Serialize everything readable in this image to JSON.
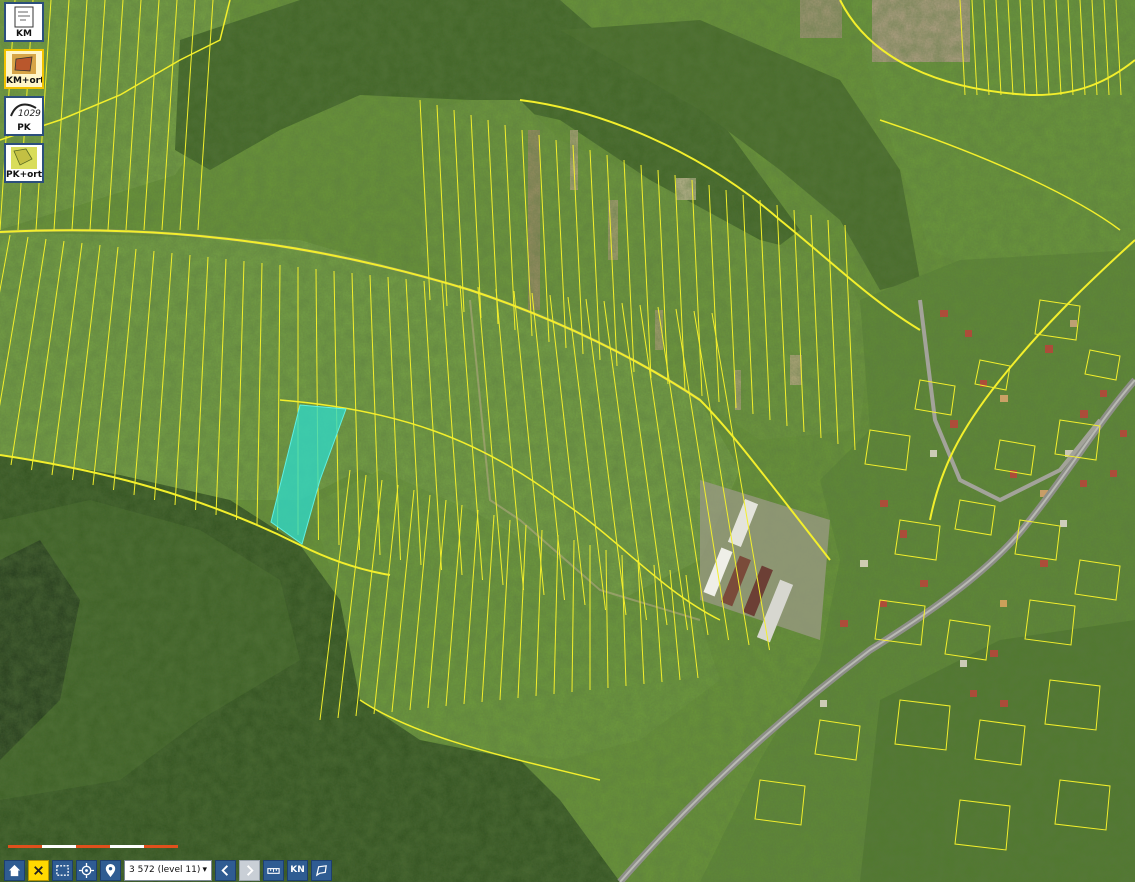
{
  "map": {
    "view": "aerial orthophoto with cadastral parcel boundaries",
    "parcel_line_color": "#f3ef2c",
    "highlight_color": "#2fd8c8",
    "forest_color": "#2c4a1c",
    "meadow_color": "#6b9a38"
  },
  "layers": [
    {
      "label": "KM",
      "icon": "cadastral-map-icon",
      "active": false
    },
    {
      "label": "KM+orto",
      "icon": "cadastral-ortho-icon",
      "active": true
    },
    {
      "label": "PK",
      "icon": "land-register-map-icon",
      "active": false
    },
    {
      "label": "PK+orto",
      "icon": "land-register-ortho-icon",
      "active": false
    }
  ],
  "toolbar": {
    "zoom_label": "3 572 (level 11)",
    "buttons": [
      "home-icon",
      "close-icon",
      "select-area-icon",
      "locate-icon",
      "pin-icon",
      "back-icon",
      "forward-icon",
      "measure-icon",
      "KN",
      "feedback-icon"
    ],
    "kn_label": "KN"
  },
  "colors": {
    "button_blue": "#2f5c92",
    "button_yellow": "#ffd900",
    "scale_red": "#e0501c"
  }
}
